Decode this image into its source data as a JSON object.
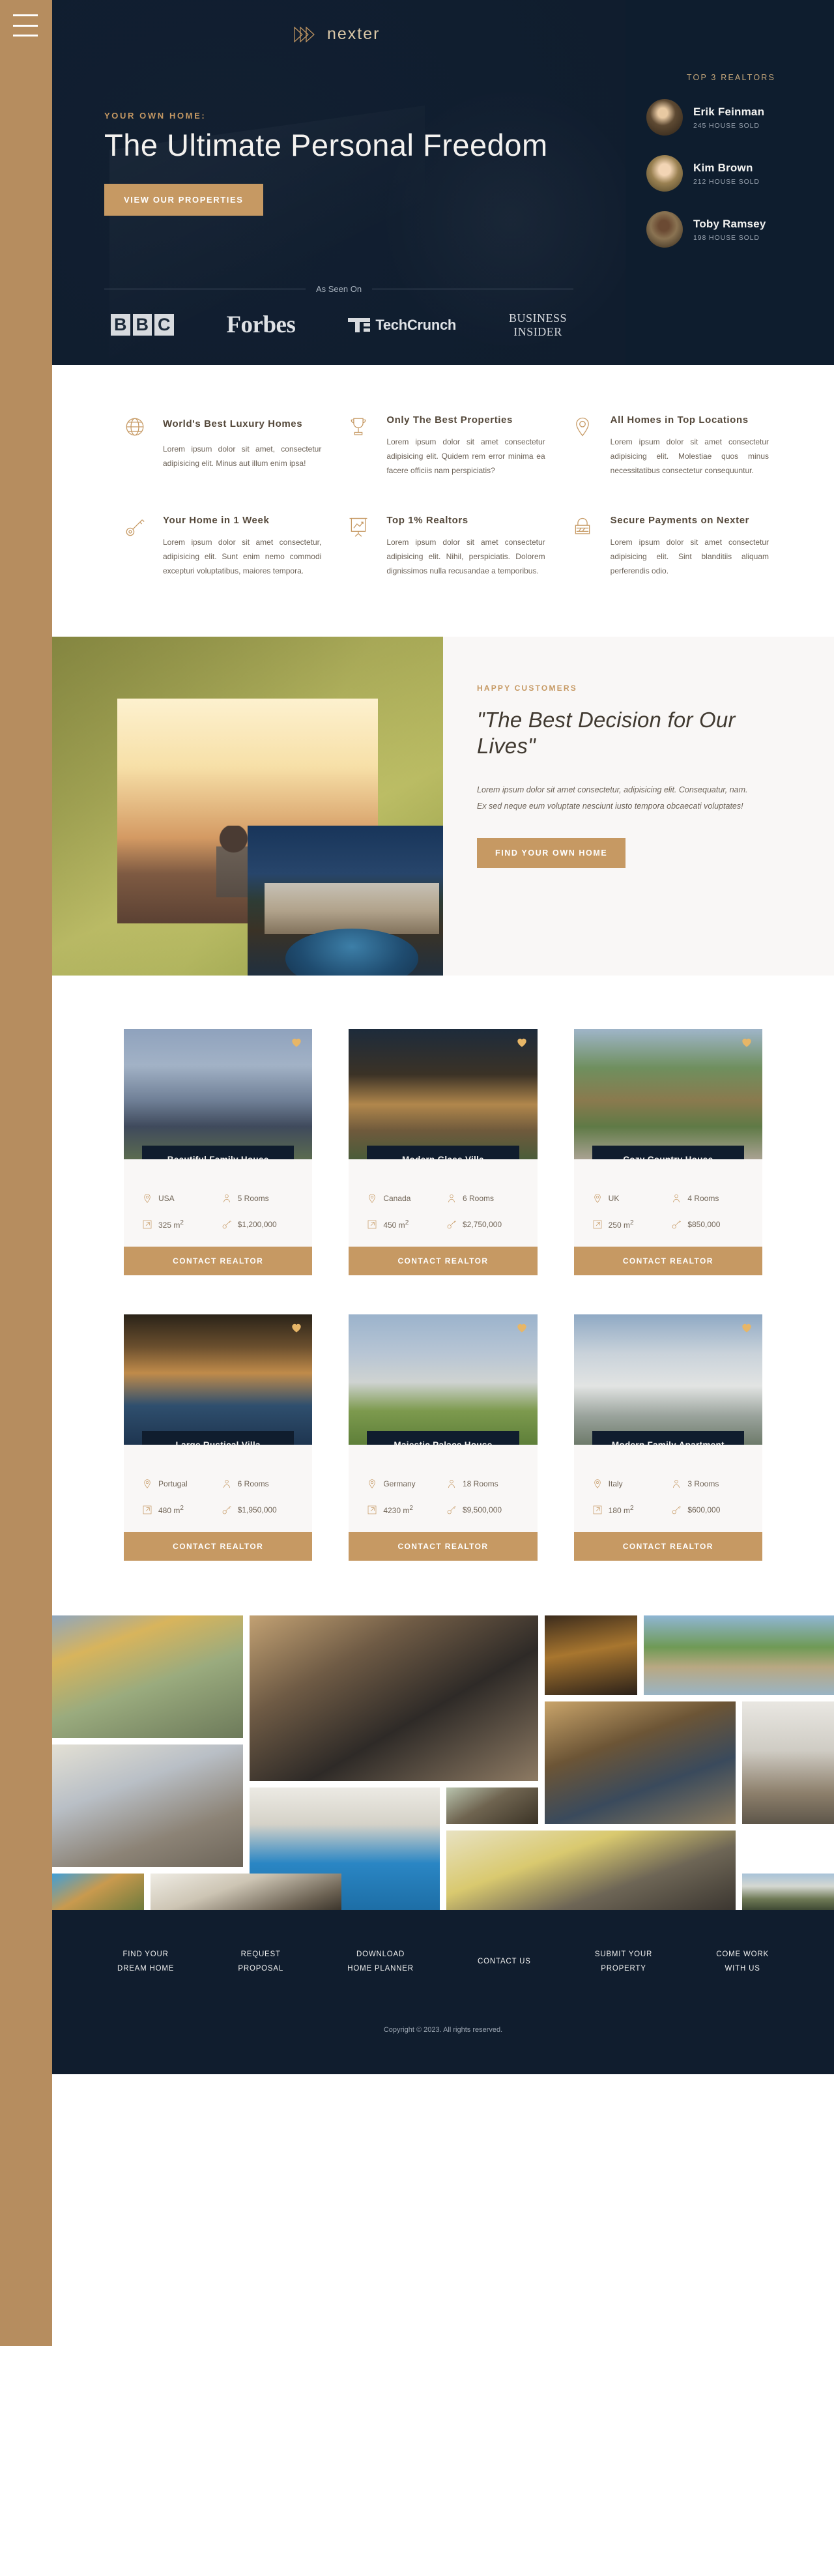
{
  "brand": {
    "name": "nexter",
    "logo_icon": "triple-chevron-logo"
  },
  "sidebar": {
    "menu_icon": "hamburger-menu-icon"
  },
  "hero": {
    "eyebrow": "YOUR OWN HOME:",
    "title": "The Ultimate Personal Freedom",
    "cta": "VIEW OUR PROPERTIES"
  },
  "seen_on": {
    "label": "As Seen On",
    "logos": [
      {
        "name": "bbc-logo",
        "letters": [
          "B",
          "B",
          "C"
        ]
      },
      {
        "name": "forbes-logo",
        "text": "Forbes"
      },
      {
        "name": "techcrunch-logo",
        "text": "TechCrunch"
      },
      {
        "name": "business-insider-logo",
        "line1": "BUSINESS",
        "line2": "INSIDER"
      }
    ]
  },
  "realtors": {
    "title": "TOP 3 REALTORS",
    "items": [
      {
        "name": "Erik Feinman",
        "sold": "245 HOUSE SOLD"
      },
      {
        "name": "Kim Brown",
        "sold": "212 HOUSE SOLD"
      },
      {
        "name": "Toby Ramsey",
        "sold": "198 HOUSE SOLD"
      }
    ]
  },
  "features": [
    {
      "icon": "globe-icon",
      "title": "World's Best Luxury Homes",
      "text": "Lorem ipsum dolor sit amet, consectetur adipisicing elit. Minus aut illum enim ipsa!"
    },
    {
      "icon": "trophy-icon",
      "title": "Only The Best Properties",
      "text": "Lorem ipsum dolor sit amet consectetur adipisicing elit. Quidem rem error minima ea facere officiis nam perspiciatis?"
    },
    {
      "icon": "map-pin-icon",
      "title": "All Homes in Top Locations",
      "text": "Lorem ipsum dolor sit amet consectetur adipisicing elit. Molestiae quos minus necessitatibus consectetur consequuntur."
    },
    {
      "icon": "key-icon",
      "title": "Your Home in 1 Week",
      "text": "Lorem ipsum dolor sit amet consectetur, adipisicing elit. Sunt enim nemo commodi excepturi voluptatibus, maiores tempora."
    },
    {
      "icon": "chart-presentation-icon",
      "title": "Top 1% Realtors",
      "text": "Lorem ipsum dolor sit amet consectetur adipisicing elit. Nihil, perspiciatis. Dolorem dignissimos nulla recusandae a temporibus."
    },
    {
      "icon": "lock-icon",
      "title": "Secure Payments on Nexter",
      "text": "Lorem ipsum dolor sit amet consectetur adipisicing elit. Sint blanditiis aliquam perferendis odio."
    }
  ],
  "story": {
    "kicker": "HAPPY CUSTOMERS",
    "quote": "\"The Best Decision for Our Lives\"",
    "body": "Lorem ipsum dolor sit amet consectetur, adipisicing elit. Consequatur, nam. Ex sed neque eum voluptate nesciunt iusto tempora obcaecati voluptates!",
    "cta": "FIND YOUR OWN HOME",
    "images": [
      "couple-sunset-photo",
      "villa-pool-night-photo"
    ]
  },
  "homes": {
    "contact_label": "CONTACT REALTOR",
    "favorite_icon": "heart-icon",
    "spec_icons": {
      "location": "map-pin-icon",
      "rooms": "person-icon",
      "area": "area-expand-icon",
      "price": "key-icon"
    },
    "items": [
      {
        "title": "Beautiful Family House",
        "location": "USA",
        "rooms": "5 Rooms",
        "area": "325 m",
        "area_sup": "2",
        "price": "$1,200,000",
        "favorite": true
      },
      {
        "title": "Modern Glass Villa",
        "location": "Canada",
        "rooms": "6 Rooms",
        "area": "450 m",
        "area_sup": "2",
        "price": "$2,750,000",
        "favorite": true
      },
      {
        "title": "Cozy Country House",
        "location": "UK",
        "rooms": "4 Rooms",
        "area": "250 m",
        "area_sup": "2",
        "price": "$850,000",
        "favorite": true
      },
      {
        "title": "Large Rustical Villa",
        "location": "Portugal",
        "rooms": "6 Rooms",
        "area": "480 m",
        "area_sup": "2",
        "price": "$1,950,000",
        "favorite": true
      },
      {
        "title": "Majestic Palace House",
        "location": "Germany",
        "rooms": "18 Rooms",
        "area": "4230 m",
        "area_sup": "2",
        "price": "$9,500,000",
        "favorite": true
      },
      {
        "title": "Modern Family Apartment",
        "location": "Italy",
        "rooms": "3 Rooms",
        "area": "180 m",
        "area_sup": "2",
        "price": "$600,000",
        "favorite": true
      }
    ]
  },
  "gallery": {
    "images": [
      "autumn-white-house",
      "wood-blind-living-room",
      "dark-wood-interior",
      "beach-bungalow",
      "tall-window-sitting-room",
      "indoor-pool-room",
      "small-house-model",
      "stone-fireplace-great-room",
      "white-modern-kitchen",
      "yellow-billiard-room",
      "villa-blue-sky",
      "chandelier-dining-room",
      "grey-modern-lounge",
      "winter-white-cottage"
    ]
  },
  "footer": {
    "links": [
      {
        "line1": "FIND YOUR",
        "line2": "DREAM HOME"
      },
      {
        "line1": "REQUEST",
        "line2": "PROPOSAL"
      },
      {
        "line1": "DOWNLOAD",
        "line2": "HOME PLANNER"
      },
      {
        "line1": "CONTACT US",
        "line2": ""
      },
      {
        "line1": "SUBMIT YOUR",
        "line2": "PROPERTY"
      },
      {
        "line1": "COME WORK",
        "line2": "WITH US"
      }
    ],
    "copyright": "Copyright © 2023. All rights reserved."
  },
  "colors": {
    "accent": "#c69963",
    "accent_dark": "#b28451",
    "dark": "#101d2e",
    "light_bg": "#f9f7f6",
    "sidebar": "#b68d5f"
  }
}
